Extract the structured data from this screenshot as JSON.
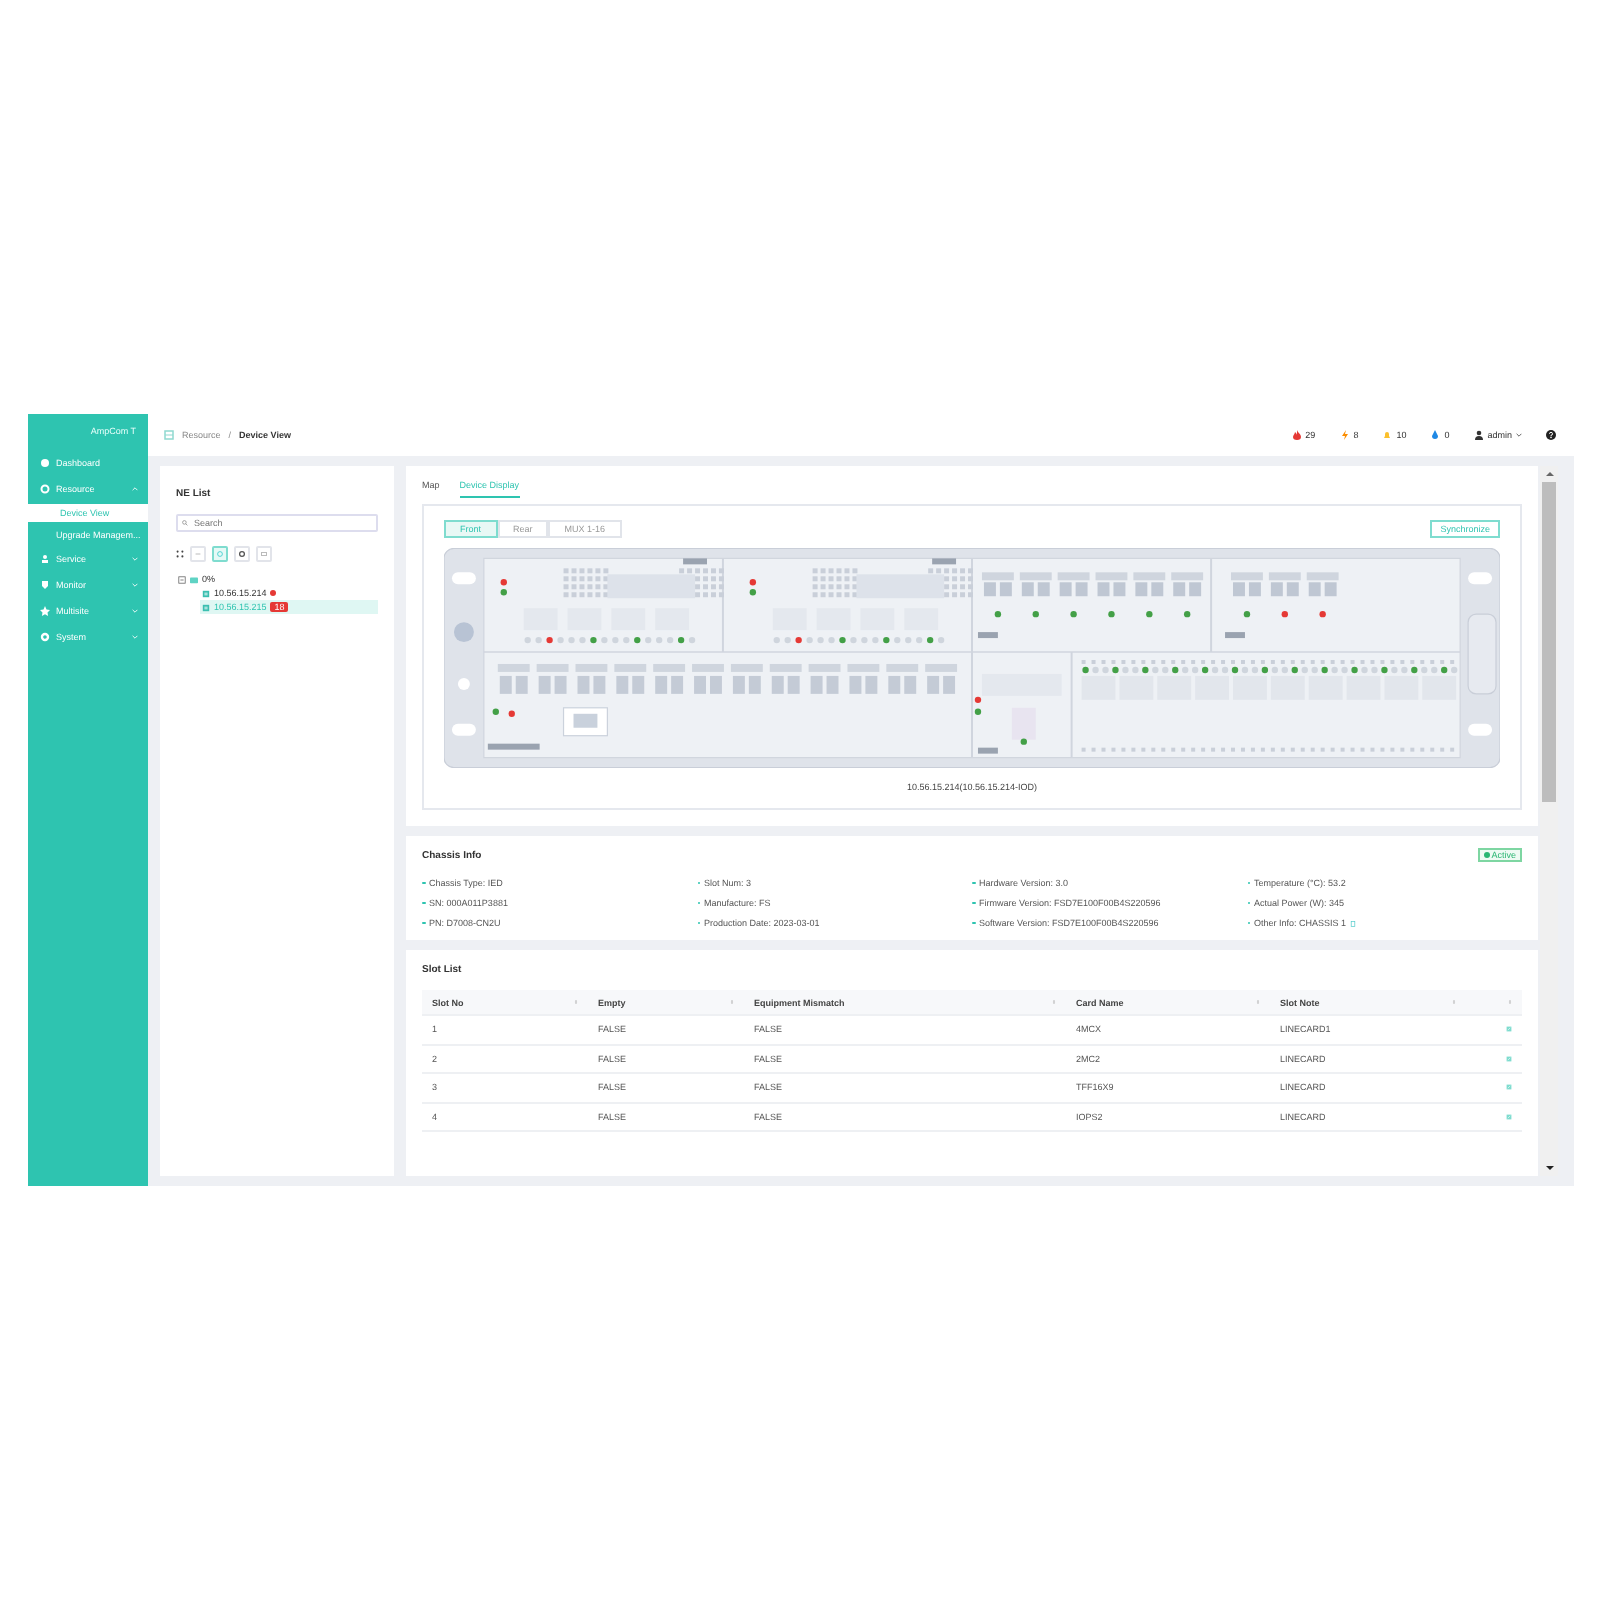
{
  "sidebar": {
    "logo": "AmpCom T",
    "items": [
      {
        "label": "Dashboard"
      },
      {
        "label": "Resource",
        "expanded": true,
        "children": [
          {
            "label": "Device View",
            "selected": true
          },
          {
            "label": "Upgrade Managem...",
            "selected": false
          }
        ]
      },
      {
        "label": "Service",
        "expanded": false
      },
      {
        "label": "Monitor",
        "expanded": false
      },
      {
        "label": "Multisite",
        "expanded": false
      },
      {
        "label": "System",
        "expanded": false
      }
    ]
  },
  "breadcrumb": [
    "Resource",
    "/",
    "Device View"
  ],
  "alarms": [
    {
      "kind": "critical",
      "count": "29",
      "color": "#e53935"
    },
    {
      "kind": "major",
      "count": "8",
      "color": "#fb8c00"
    },
    {
      "kind": "minor",
      "count": "10",
      "color": "#fbc02d"
    },
    {
      "kind": "warning",
      "count": "0",
      "color": "#1e88e5"
    }
  ],
  "user": "admin",
  "ne_list": {
    "title": "NE List",
    "search": {
      "placeholder": "Search"
    },
    "tree": [
      {
        "label": "0%",
        "expanded": true,
        "children": [
          {
            "label": "10.56.15.214",
            "selected": false,
            "color": "#e53935"
          },
          {
            "label": "10.56.15.215",
            "selected": true,
            "badge": "18"
          }
        ]
      }
    ]
  },
  "tabs": [
    {
      "label": "Map",
      "selected": false
    },
    {
      "label": "Device Display",
      "selected": true
    }
  ],
  "views": [
    {
      "label": "Front",
      "selected": true
    },
    {
      "label": "Rear",
      "selected": false
    },
    {
      "label": "MUX 1-16",
      "selected": false
    }
  ],
  "sync_button": "Synchronize",
  "device_caption": "10.56.15.214(10.56.15.214-IOD)",
  "chassis_info": {
    "title": "Chassis Info",
    "status": "Active",
    "fields": [
      {
        "label": "Chassis Type: IED",
        "copy": false
      },
      {
        "label": "Slot Num: 3",
        "copy": false
      },
      {
        "label": "Hardware Version: 3.0",
        "copy": false
      },
      {
        "label": "Temperature (°C): 53.2",
        "copy": false
      },
      {
        "label": "SN: 000A011P3881",
        "copy": false
      },
      {
        "label": "Manufacture: FS",
        "copy": false
      },
      {
        "label": "Firmware Version: FSD7E100F00B4S220596",
        "copy": false
      },
      {
        "label": "Actual Power (W): 345",
        "copy": false
      },
      {
        "label": "PN: D7008-CN2U",
        "copy": false
      },
      {
        "label": "Production Date: 2023-03-01",
        "copy": false
      },
      {
        "label": "Software Version: FSD7E100F00B4S220596",
        "copy": false
      },
      {
        "label": "Other Info: CHASSIS 1",
        "copy": true
      }
    ]
  },
  "slot_list": {
    "title": "Slot List",
    "columns": [
      "Slot No",
      "Empty",
      "Equipment Mismatch",
      "Card Name",
      "Slot Note"
    ],
    "rows": [
      [
        "1",
        "FALSE",
        "FALSE",
        "4MCX",
        "LINECARD1"
      ],
      [
        "2",
        "FALSE",
        "FALSE",
        "2MC2",
        "LINECARD"
      ],
      [
        "3",
        "FALSE",
        "FALSE",
        "TFF16X9",
        "LINECARD"
      ],
      [
        "4",
        "FALSE",
        "FALSE",
        "IOPS2",
        "LINECARD"
      ]
    ]
  }
}
